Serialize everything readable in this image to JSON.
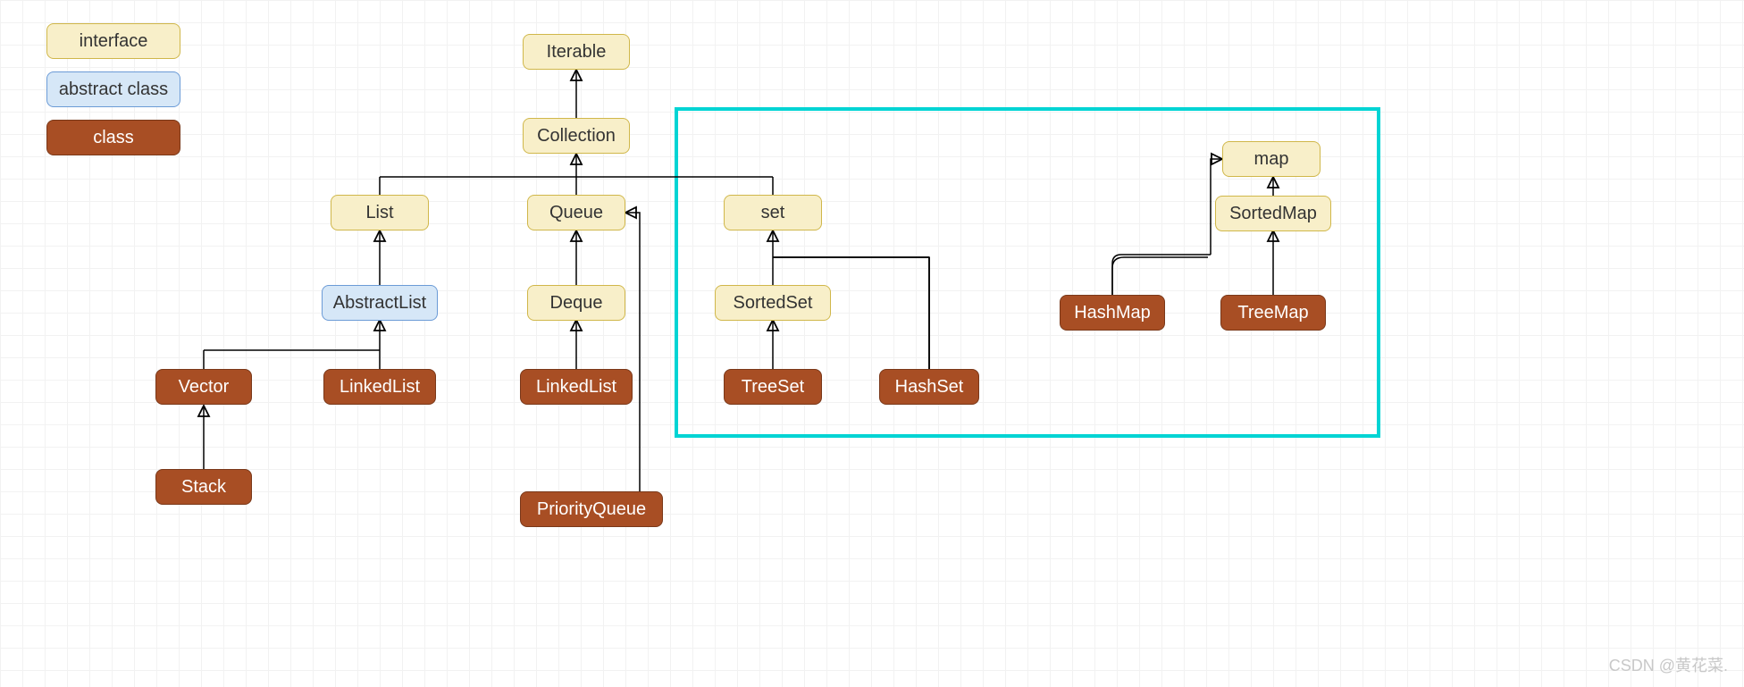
{
  "legend": {
    "interface": "interface",
    "abstract": "abstract class",
    "class": "class"
  },
  "nodes": {
    "iterable": "Iterable",
    "collection": "Collection",
    "list": "List",
    "queue": "Queue",
    "set": "set",
    "map": "map",
    "abstractlist": "AbstractList",
    "deque": "Deque",
    "sortedset": "SortedSet",
    "sortedmap": "SortedMap",
    "vector": "Vector",
    "linkedlist1": "LinkedList",
    "linkedlist2": "LinkedList",
    "treeset": "TreeSet",
    "hashset": "HashSet",
    "hashmap": "HashMap",
    "treemap": "TreeMap",
    "stack": "Stack",
    "priorityqueue": "PriorityQueue"
  },
  "watermark": "CSDN @黄花菜.",
  "colors": {
    "interface_bg": "#f8efc9",
    "abstract_bg": "#d6e7f7",
    "class_bg": "#a84e24",
    "highlight": "#00d4d4"
  }
}
